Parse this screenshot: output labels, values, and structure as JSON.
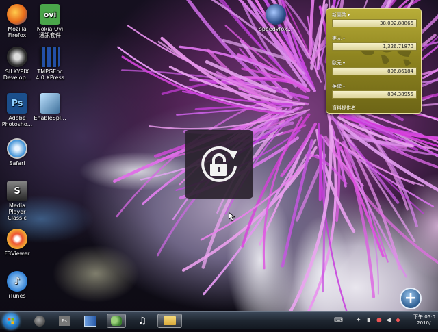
{
  "desktop_icons": [
    {
      "id": "firefox",
      "label": "Mozilla Firefox",
      "lines": [
        "Mozilla",
        "Firefox"
      ],
      "icon": "firefox-icon",
      "color": "#e86a1a"
    },
    {
      "id": "nokia-ovi",
      "label": "Nokia Ovi 通訊套件",
      "lines": [
        "Nokia Ovi",
        "通訊套件"
      ],
      "icon": "ovi-icon",
      "glyph": "ovi",
      "color": "#4aa64a"
    },
    {
      "id": "silkypix",
      "label": "SILKYPIX Develop...",
      "lines": [
        "SILKYPIX",
        "Develop..."
      ],
      "icon": "silkypix-icon",
      "color": "#2c2c2c"
    },
    {
      "id": "tmpgenc",
      "label": "TMPGEnc 4.0 XPress",
      "lines": [
        "TMPGEnc",
        "4.0 XPress"
      ],
      "icon": "tmpgenc-icon",
      "color": "#2350a5"
    },
    {
      "id": "photoshop",
      "label": "Adobe Photosho...",
      "lines": [
        "Adobe",
        "Photosho..."
      ],
      "icon": "photoshop-icon",
      "glyph": "Ps",
      "color": "#1b4f8c"
    },
    {
      "id": "enablespl",
      "label": "EnableSpl...",
      "lines": [
        "EnableSpl..."
      ],
      "icon": "enablespl-icon",
      "color": "#3d6f9a"
    },
    {
      "id": "safari",
      "label": "Safari",
      "lines": [
        "Safari"
      ],
      "icon": "safari-icon",
      "color": "#3a8fd6"
    },
    {
      "id": "mpc",
      "label": "Media Player Classic",
      "lines": [
        "Media",
        "Player",
        "Classic"
      ],
      "icon": "media-player-classic-icon",
      "glyph": "S",
      "color": "#3a3a3a"
    },
    {
      "id": "f3viewer",
      "label": "F3Viewer",
      "lines": [
        "F3Viewer"
      ],
      "icon": "f3viewer-icon",
      "color": "#d9801c"
    },
    {
      "id": "itunes",
      "label": "iTunes",
      "lines": [
        "iTunes"
      ],
      "icon": "itunes-icon",
      "color": "#2f7fd4"
    },
    {
      "id": "speedyfox",
      "label": "speedyfox...",
      "lines": [
        "speedyfox..."
      ],
      "icon": "speedyfox-icon",
      "color": "#2d4f8a"
    }
  ],
  "gadget": {
    "rows": [
      {
        "currency": "新臺幣",
        "value": "38,002.88866"
      },
      {
        "currency": "美元",
        "value": "1,326.71870"
      },
      {
        "currency": "歐元",
        "value": "896.86184"
      },
      {
        "currency": "英鎊",
        "value": "804.38955"
      }
    ],
    "caret": "▾",
    "source": "資料提供者"
  },
  "taskbar": {
    "items": [
      {
        "id": "firefox",
        "icon": "firefox-icon",
        "color": "#e86a1a"
      },
      {
        "id": "photoshop",
        "icon": "photoshop-icon",
        "glyph": "Ps",
        "color": "#1b4f8c"
      },
      {
        "id": "book",
        "icon": "book-icon",
        "color": "#3a6fb5"
      },
      {
        "id": "messenger",
        "icon": "messenger-icon",
        "color": "#6aa84f"
      },
      {
        "id": "music",
        "icon": "music-note-icon",
        "glyph": "♫",
        "color": "#ffffff"
      },
      {
        "id": "folder",
        "icon": "folder-icon",
        "color": "#e2b84a"
      }
    ],
    "clock": {
      "time": "下午 05:0",
      "date": "2010/..."
    }
  },
  "overlay": {
    "icon": "rotate-lock-icon"
  },
  "plus_button": {
    "label": "+"
  }
}
